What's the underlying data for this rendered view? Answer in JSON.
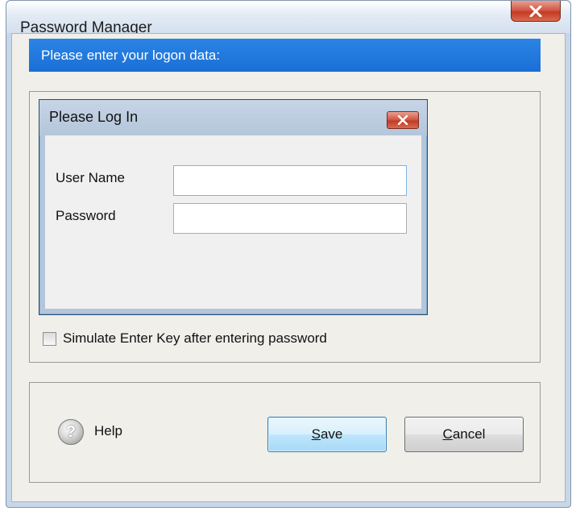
{
  "window": {
    "title": "Password Manager",
    "close_icon": "close-x-icon"
  },
  "header": {
    "text": "Please enter your logon data:"
  },
  "preview": {
    "title": "Please Log In",
    "close_icon": "close-x-icon",
    "user_name_label": "User Name",
    "user_name_value": "",
    "password_label": "Password",
    "password_value": ""
  },
  "options": {
    "simulate_enter_label": "Simulate Enter Key after entering password",
    "simulate_enter_checked": false
  },
  "footer": {
    "help_icon": "question-mark-icon",
    "help_label": "Help",
    "save_first": "S",
    "save_rest": "ave",
    "cancel_first": "C",
    "cancel_rest": "ancel"
  },
  "colors": {
    "header_bar": "#1a6fd5",
    "close_button": "#c23a22",
    "save_button_border": "#3c7fb1"
  }
}
